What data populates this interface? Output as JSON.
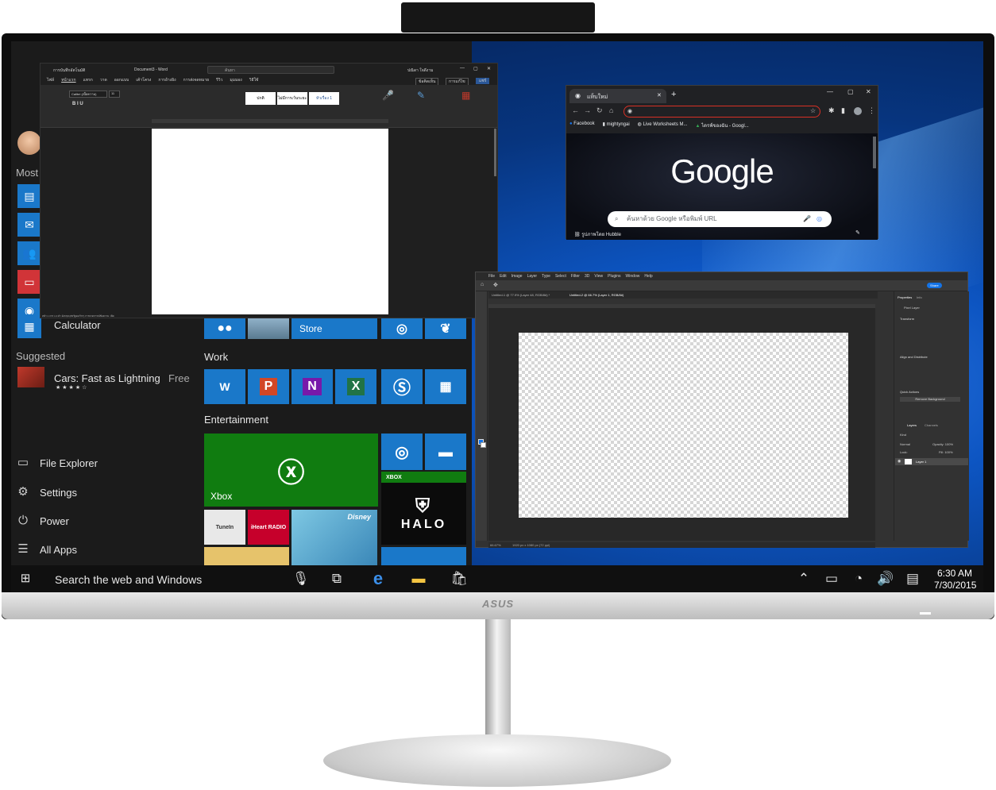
{
  "start_menu": {
    "section_most": "Most",
    "calculator": "Calculator",
    "section_suggested": "Suggested",
    "suggested_app": "Cars: Fast as Lightning",
    "suggested_price": "Free",
    "section_work": "Work",
    "section_entertainment": "Entertainment",
    "store_tile": "Store",
    "xbox_tile": "Xbox",
    "xbox_live_badge": "XBOX",
    "halo_tile": "HALO",
    "tunein_tile": "TuneIn",
    "iheart_tile": "iHeart RADIO",
    "disney_tile": "Disney",
    "file_explorer": "File Explorer",
    "settings": "Settings",
    "power": "Power",
    "all_apps": "All Apps"
  },
  "taskbar": {
    "search_text": "Search the web and Windows",
    "time": "6:30 AM",
    "date": "7/30/2015"
  },
  "word": {
    "autosave": "การบันทึกอัตโนมัติ",
    "doc_title": "Document3 - Word",
    "search": "ค้นหา",
    "user": "ปณิดา ใจดีงาม",
    "tabs": [
      "ไฟล์",
      "หน้าแรก",
      "แทรก",
      "วาด",
      "ออกแบบ",
      "เค้าโครง",
      "การอ้างอิง",
      "การส่งจดหมาย",
      "รีวิว",
      "มุมมอง",
      "วิธีใช้"
    ],
    "comments": "ข้อคิดเห็น",
    "editing": "การแก้ไข",
    "share": "แชร์",
    "font_name": "Calibri (เนื้อความ)",
    "font_size": "11",
    "styles": [
      "ปกติ",
      "ไม่มีการเว้นระยะ",
      "หัวเรื่อง 1"
    ],
    "status": "หน้า 1 จาก 1   0 คำ   อังกฤษ (สหรัฐอเมริกา)   การคาดการณ์ข้อความ: เปิด"
  },
  "chrome": {
    "tab_title": "แท็บใหม่",
    "bookmarks": [
      "Facebook",
      "mightyngai",
      "Live Worksheets M...",
      "ไดรฟ์ของฉัน - Googl..."
    ],
    "logo": "Google",
    "search_placeholder": "ค้นหาด้วย Google หรือพิมพ์ URL",
    "footer_link": "รูปภาพโดย Hubble"
  },
  "photoshop": {
    "menu": [
      "File",
      "Edit",
      "Image",
      "Layer",
      "Type",
      "Select",
      "Filter",
      "3D",
      "View",
      "Plugins",
      "Window",
      "Help"
    ],
    "tab1": "Untitled-1 @ 77.9% (Layer 48, RGB/8#) *",
    "tab2": "Untitled-2 @ 66.7% (Layer 1, RGB/8#)",
    "share": "Share",
    "properties": "Properties",
    "info": "Info",
    "pixel_layer": "Pixel Layer",
    "transform": "Transform",
    "align": "Align and Distribute",
    "quick_actions": "Quick Actions",
    "remove_bg": "Remove Background",
    "layers": "Layers",
    "channels": "Channels",
    "kind": "Kind",
    "normal": "Normal",
    "opacity": "Opacity: 100%",
    "lock": "Lock:",
    "fill": "Fill: 100%",
    "layer_name": "Layer 1",
    "zoom": "66.67%",
    "doc_size": "1920 px x 1080 px (72 ppi)"
  },
  "brand": "ASUS"
}
